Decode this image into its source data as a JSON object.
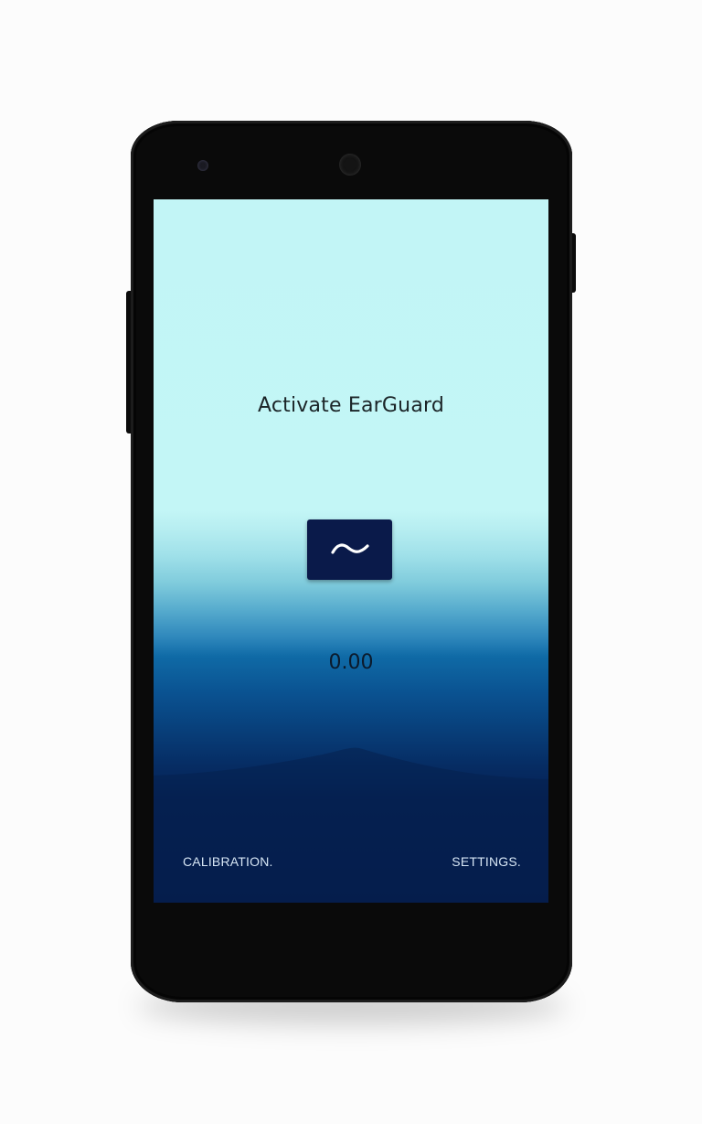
{
  "app": {
    "name": "EarGuard"
  },
  "main": {
    "activate_label": "Activate EarGuard",
    "activate_button_icon": "tilde-wave-icon",
    "level_value": "0.00"
  },
  "footer": {
    "calibration_label": "CALIBRATION.",
    "settings_label": "SETTINGS."
  },
  "colors": {
    "screen_top": "#c2f5f6",
    "screen_bottom": "#061a4b",
    "button_bg": "#0a1a4a",
    "title_text": "#1b2427",
    "footer_text": "#d7e6f5"
  }
}
